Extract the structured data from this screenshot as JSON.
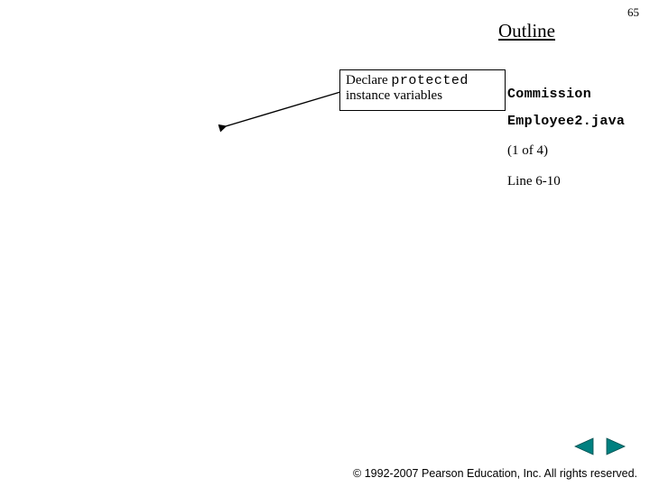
{
  "page_number": "65",
  "heading": "Outline",
  "callout": {
    "prefix": "Declare ",
    "keyword": "protected",
    "line2": "instance variables"
  },
  "right": {
    "file_line1": "Commission",
    "file_line2": "Employee2.java",
    "sub": "(1 of 4)",
    "line_ref": "Line 6-10"
  },
  "nav": {
    "prev": "previous",
    "next": "next"
  },
  "copyright": "© 1992-2007 Pearson Education, Inc. All rights reserved."
}
